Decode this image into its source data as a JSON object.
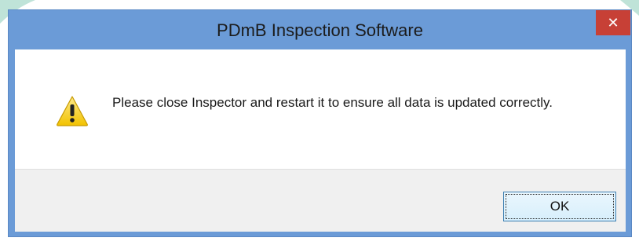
{
  "dialog": {
    "title": "PDmB Inspection Software",
    "close_label": "✕",
    "message": "Please close Inspector and restart it to ensure all data is updated correctly.",
    "icon": "warning-icon",
    "ok_label": "OK"
  },
  "colors": {
    "titlebar": "#6b9bd7",
    "close_button": "#c74036",
    "footer": "#f0f0f0"
  }
}
